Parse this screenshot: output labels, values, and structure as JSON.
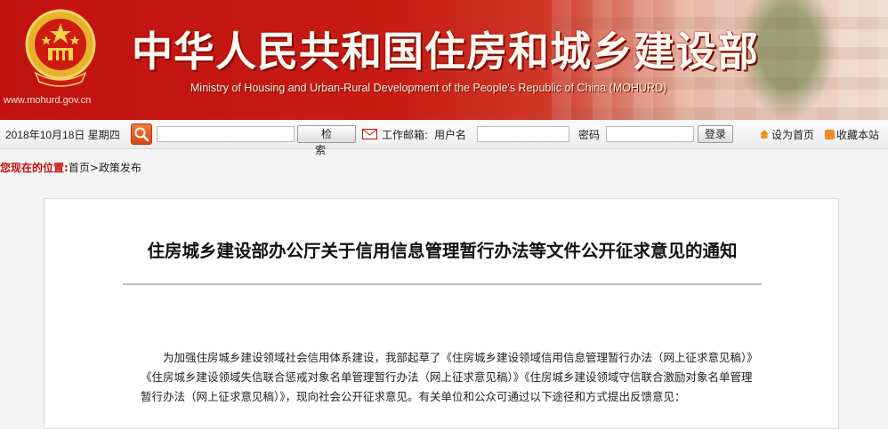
{
  "header": {
    "site_url": "www.mohurd.gov.cn",
    "title_cn": "中华人民共和国住房和城乡建设部",
    "title_en": "Ministry of Housing and Urban-Rural Development of the People's Republic of China (MOHURD)"
  },
  "toolbar": {
    "date": "2018年10月18日  星期四",
    "search_value": "",
    "search_button": "检索",
    "mail_label": "工作邮箱:",
    "username_label": "用户名",
    "username_value": "",
    "password_label": "密码",
    "password_value": "",
    "login_button": "登录",
    "set_home": "设为首页",
    "bookmark": "收藏本站"
  },
  "breadcrumb": {
    "label": "您现在的位置:",
    "path": "首页>政策发布"
  },
  "article": {
    "title": "住房城乡建设部办公厅关于信用信息管理暂行办法等文件公开征求意见的通知",
    "body": "为加强住房城乡建设领域社会信用体系建设，我部起草了《住房城乡建设领域信用信息管理暂行办法（网上征求意见稿）》《住房城乡建设领域失信联合惩戒对象名单管理暂行办法（网上征求意见稿）》《住房城乡建设领域守信联合激励对象名单管理暂行办法（网上征求意见稿）》，现向社会公开征求意见。有关单位和公众可通过以下途径和方式提出反馈意见："
  },
  "colors": {
    "banner_red": "#c0110f",
    "breadcrumb_label": "#c4100e"
  }
}
